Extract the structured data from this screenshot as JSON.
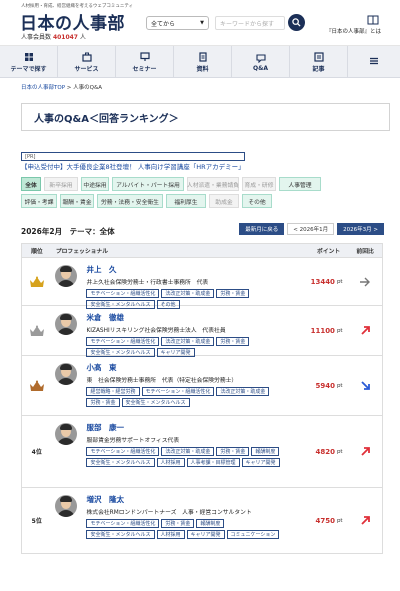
{
  "header": {
    "tagline": "人材採用・育成、経営組織を考えるウェブコミュニティ",
    "logo": "日本の人事部",
    "members_label": "人事会員数",
    "members_count": "401047",
    "members_unit": "人",
    "category_select": "全てから",
    "search_placeholder": "キーワードから探す",
    "about_link": "『日本の人事部』とは"
  },
  "nav": [
    {
      "label": "テーマで探す",
      "icon": "grid-icon"
    },
    {
      "label": "サービス",
      "icon": "service-icon"
    },
    {
      "label": "セミナー",
      "icon": "seminar-icon"
    },
    {
      "label": "資料",
      "icon": "document-icon"
    },
    {
      "label": "Q&A",
      "icon": "qa-icon"
    },
    {
      "label": "記事",
      "icon": "article-icon"
    },
    {
      "label": "",
      "icon": "menu-icon"
    }
  ],
  "breadcrumb": {
    "home": "日本の人事部TOP",
    "sep": ">",
    "current": "人事のQ&A"
  },
  "page_title": "人事のQ&A＜回答ランキング＞",
  "pr": {
    "tag": "[PR]",
    "link": "【申込受付中】大手優良企業8社登壇！ 人事向け学習講座「HRアカデミー」"
  },
  "filters": {
    "row1": [
      {
        "label": "全体",
        "state": "active"
      },
      {
        "label": "新卒採用",
        "state": "dim"
      },
      {
        "label": "中途採用",
        "state": "normal"
      },
      {
        "label": "アルバイト・パート採用",
        "state": "normal"
      },
      {
        "label": "人材派遣・業務請負",
        "state": "dim"
      },
      {
        "label": "育成・研修",
        "state": "dim"
      },
      {
        "label": "人事管理",
        "state": "normal"
      }
    ],
    "row2": [
      {
        "label": "評価・考課",
        "state": "normal"
      },
      {
        "label": "報酬・賃金",
        "state": "normal"
      },
      {
        "label": "労務・法務・安全衛生",
        "state": "normal"
      },
      {
        "label": "福利厚生",
        "state": "normal"
      },
      {
        "label": "助成金",
        "state": "dim"
      },
      {
        "label": "その他",
        "state": "normal"
      }
    ]
  },
  "period": "2026年2月　テーマ：全体",
  "month_buttons": {
    "latest": "最新月に戻る",
    "prev": "< 2026年1月",
    "next": "2026年3月 >"
  },
  "table_headers": {
    "rank": "順位",
    "pro": "プロフェッショナル",
    "point": "ポイント",
    "prev": "前回比"
  },
  "rows": [
    {
      "rank": "",
      "crown": "gold",
      "name": "井上　久",
      "org": "井上久社会保険労務士・行政書士事務所　代表",
      "tags": [
        "モチベーション・組織活性化",
        "法改正対策・助成金",
        "労務・賃金",
        "安全衛生・メンタルヘルス",
        "その他"
      ],
      "points": "13440",
      "unit": "pt",
      "trend": "flat"
    },
    {
      "rank": "",
      "crown": "silver",
      "name": "米倉　徹雄",
      "org": "KIZASHIリスキリング社会保険労務士法人　代表社員",
      "tags": [
        "モチベーション・組織活性化",
        "法改正対策・助成金",
        "労務・賃金",
        "安全衛生・メンタルヘルス",
        "キャリア開発"
      ],
      "points": "11100",
      "unit": "pt",
      "trend": "up"
    },
    {
      "rank": "",
      "crown": "bronze",
      "name": "小髙　東",
      "org": "東　社会保険労務士事務所　代表（特定社会保険労務士）",
      "tags": [
        "経営戦略・経営労務",
        "モチベーション・組織活性化",
        "法改正対策・助成金",
        "労務・賃金",
        "安全衛生・メンタルヘルス"
      ],
      "points": "5940",
      "unit": "pt",
      "trend": "down"
    },
    {
      "rank": "4位",
      "crown": "",
      "name": "服部　康一",
      "org": "服部賃金労務サポートオフィス代表",
      "tags": [
        "モチベーション・組織活性化",
        "法改正対策・助成金",
        "労務・賃金",
        "報酬制度",
        "安全衛生・メンタルヘルス",
        "人材採用",
        "人事考課・目標管理",
        "キャリア開発"
      ],
      "points": "4820",
      "unit": "pt",
      "trend": "up"
    },
    {
      "rank": "5位",
      "crown": "",
      "name": "増沢　隆太",
      "org": "株式会社RMロンドンパートナーズ　人事・経営コンサルタント",
      "tags": [
        "モチベーション・組織活性化",
        "労務・賃金",
        "報酬制度",
        "安全衛生・メンタルヘルス",
        "人材採用",
        "キャリア開発",
        "コミュニケーション"
      ],
      "points": "4750",
      "unit": "pt",
      "trend": "up"
    }
  ],
  "colors": {
    "navy": "#1b2f57",
    "accent_red": "#c8302e",
    "filter_green": "#e3f5ee",
    "link_blue": "#1a4aa0"
  }
}
